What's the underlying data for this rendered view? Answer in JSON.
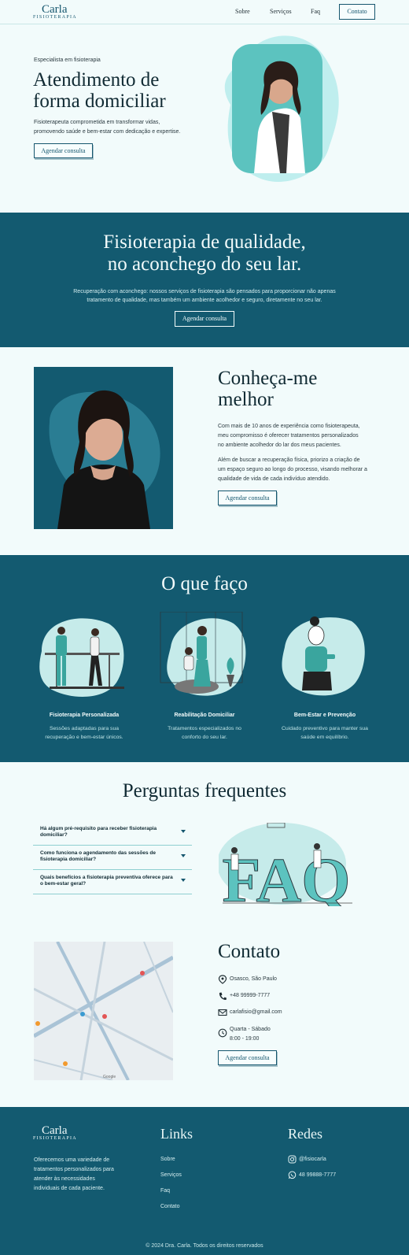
{
  "nav": {
    "logo_name": "Carla",
    "logo_sub": "FISIOTERAPIA",
    "links": [
      "Sobre",
      "Serviços",
      "Faq"
    ],
    "contact_button": "Contato"
  },
  "hero": {
    "eyebrow": "Especialista em fisioterapia",
    "title_line1": "Atendimento de",
    "title_line2": "forma domiciliar",
    "desc_line1": "Fisioterapeuta comprometida em transformar vidas,",
    "desc_line2": "promovendo saúde e bem-estar com dedicação e expertise.",
    "cta": "Agendar consulta"
  },
  "quality": {
    "title_line1": "Fisioterapia de qualidade,",
    "title_line2": "no aconchego do seu lar.",
    "desc_line1": "Recuperação com aconchego: nossos serviços de fisioterapia são pensados para proporcionar não apenas",
    "desc_line2": "tratamento de qualidade, mas também um ambiente acolhedor e seguro, diretamente no seu lar.",
    "cta": "Agendar consulta"
  },
  "about": {
    "title_line1": "Conheça-me",
    "title_line2": "melhor",
    "p1": [
      "Com mais de 10 anos de experiência como fisioterapeuta,",
      "meu compromisso é oferecer tratamentos personalizados",
      "no ambiente acolhedor do lar dos meus pacientes."
    ],
    "p2": [
      "Além de buscar a recuperação física, priorizo a criação de",
      "um espaço seguro ao longo do processo, visando melhorar a",
      "qualidade de vida de cada indivíduo atendido."
    ],
    "cta": "Agendar consulta"
  },
  "services": {
    "title": "O que faço",
    "items": [
      {
        "title": "Fisioterapia Personalizada",
        "desc1": "Sessões adaptadas para sua",
        "desc2": "recuperação e bem-estar únicos."
      },
      {
        "title": "Reabilitação Domiciliar",
        "desc1": "Tratamentos especializados no",
        "desc2": "conforto do seu lar."
      },
      {
        "title": "Bem-Estar e Prevenção",
        "desc1": "Cuidado preventivo para manter sua",
        "desc2": "saúde em equilíbrio."
      }
    ]
  },
  "faq": {
    "title": "Perguntas frequentes",
    "questions": [
      "Há algum pré-requisito para receber fisioterapia domiciliar?",
      "Como funciona o agendamento das sessões de fisioterapia domiciliar?",
      "Quais benefícios a fisioterapia preventiva oferece para o bem-estar geral?"
    ],
    "illustration_text": "FAQ"
  },
  "contact": {
    "title": "Contato",
    "location": "Osasco, São Paulo",
    "phone": "+48 99999-7777",
    "email": "carlafisio@gmail.com",
    "hours_line1": "Quarta - Sábado",
    "hours_line2": "8:00 - 19:00",
    "cta": "Agendar consulta",
    "map_brand": "Google"
  },
  "footer": {
    "logo_name": "Carla",
    "logo_sub": "FISIOTERAPIA",
    "desc": [
      "Oferecemos uma variedade de",
      "tratamentos personalizados para",
      "atender às necessidades",
      "individuais de cada paciente."
    ],
    "links_title": "Links",
    "links": [
      "Sobre",
      "Serviços",
      "Faq",
      "Contato"
    ],
    "social_title": "Redes",
    "instagram": "@fisiocarla",
    "whatsapp": "48 99888-7777",
    "copyright": "© 2024 Dra. Carla. Todos os direitos reservados"
  },
  "colors": {
    "primary": "#135a70",
    "accent": "#5cc3bf",
    "background": "#f2fbfb"
  }
}
